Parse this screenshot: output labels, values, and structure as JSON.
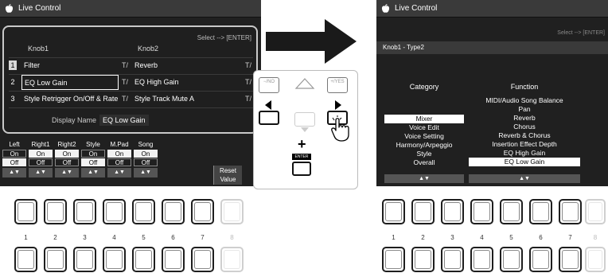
{
  "left_screen": {
    "title": "Live Control",
    "select_hint": "Select --> [ENTER]",
    "knob1_header": "Knob1",
    "knob2_header": "Knob2",
    "rows": [
      {
        "num": "1",
        "knob1": "Filter",
        "knob2": "Reverb",
        "type_icon": "T/"
      },
      {
        "num": "2",
        "knob1": "EQ Low Gain",
        "knob2": "EQ High Gain",
        "type_icon": "T/"
      },
      {
        "num": "3",
        "knob1": "Style Retrigger On/Off & Rate",
        "knob2": "Style Track Mute A",
        "type_icon": "T/"
      }
    ],
    "display_name_label": "Display Name",
    "display_name_value": "EQ Low Gain",
    "parts": [
      {
        "name": "Left",
        "on": "On",
        "off": "Off",
        "state": "off",
        "arrows": "▲▼"
      },
      {
        "name": "Right1",
        "on": "On",
        "off": "Off",
        "state": "on",
        "arrows": "▲▼"
      },
      {
        "name": "Right2",
        "on": "On",
        "off": "Off",
        "state": "on",
        "arrows": "▲▼"
      },
      {
        "name": "Style",
        "on": "On",
        "off": "Off",
        "state": "off",
        "arrows": "▲▼"
      },
      {
        "name": "M.Pad",
        "on": "On",
        "off": "Off",
        "state": "on",
        "arrows": "▲▼"
      },
      {
        "name": "Song",
        "on": "On",
        "off": "Off",
        "state": "on",
        "arrows": "▲▼"
      }
    ],
    "reset_label_1": "Reset",
    "reset_label_2": "Value"
  },
  "controls": {
    "no_label": "−/NO",
    "yes_label": "+/YES",
    "plus_label": "+",
    "enter_label": "ENTER"
  },
  "right_screen": {
    "title": "Live Control",
    "select_hint": "Select --> [ENTER]",
    "type_label": "Knob1 - Type2",
    "category_header": "Category",
    "function_header": "Function",
    "categories": [
      "Mixer",
      "Voice Edit",
      "Voice Setting",
      "Harmony/Arpeggio",
      "Style",
      "Overall"
    ],
    "selected_category": "Mixer",
    "functions": [
      "MIDI/Audio Song Balance",
      "Pan",
      "Reverb",
      "Chorus",
      "Reverb & Chorus",
      "Insertion Effect Depth",
      "EQ High Gain",
      "EQ Low Gain"
    ],
    "selected_function": "EQ Low Gain",
    "arrows": "▲▼"
  },
  "button_numbers": [
    "1",
    "2",
    "3",
    "4",
    "5",
    "6",
    "7",
    "8"
  ]
}
